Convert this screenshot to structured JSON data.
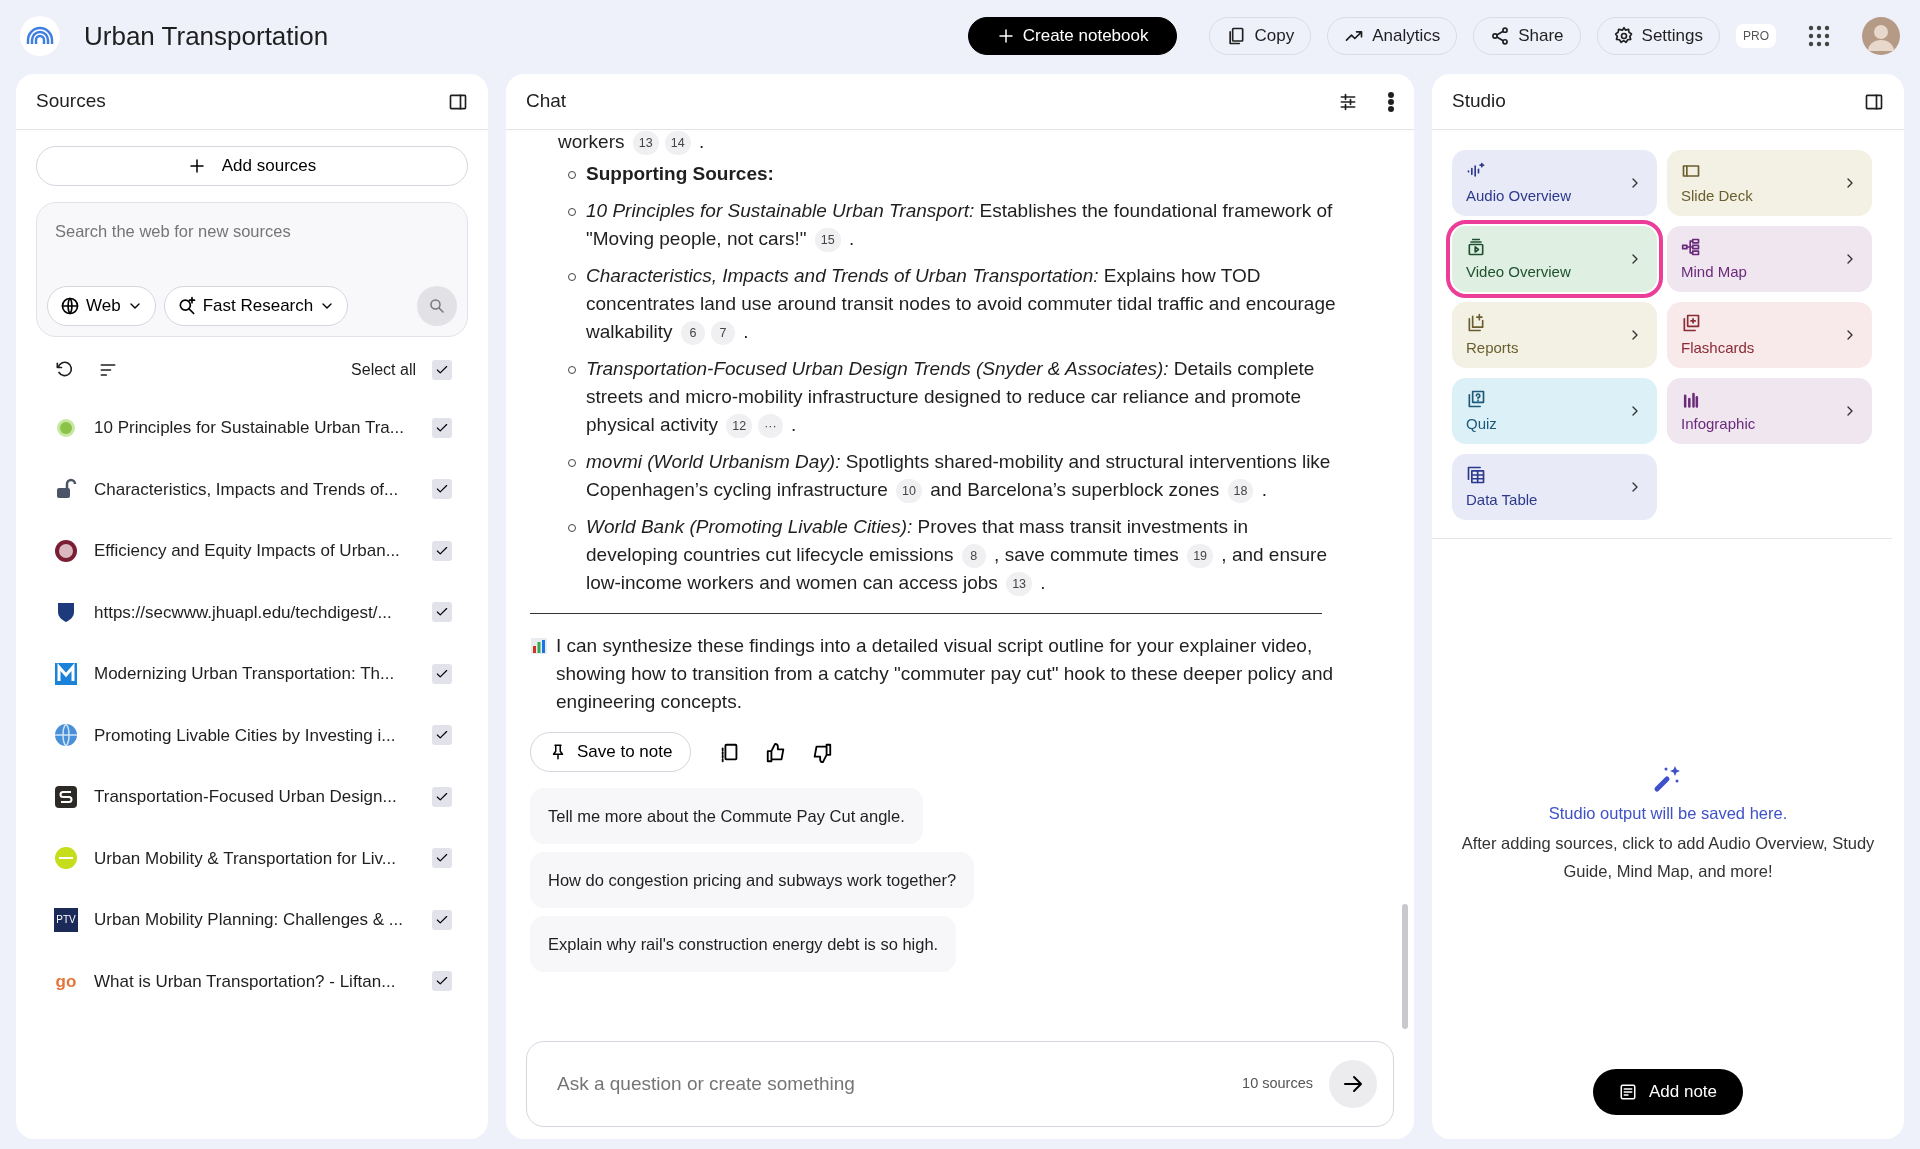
{
  "app": {
    "title": "Urban Transportation"
  },
  "toolbar": {
    "buttons": [
      {
        "kind": "create",
        "label": "Create notebook"
      },
      {
        "kind": "copy",
        "label": "Copy"
      },
      {
        "kind": "analytics",
        "label": "Analytics"
      },
      {
        "kind": "share",
        "label": "Share"
      },
      {
        "kind": "settings",
        "label": "Settings"
      }
    ],
    "badge": "PRO"
  },
  "sources": {
    "title": "Sources",
    "add_button": "Add sources",
    "search": {
      "placeholder": "Search the web for new sources",
      "web_dropdown": "Web",
      "research_dropdown": "Fast Research"
    },
    "select_all": {
      "label": "Select all",
      "checked": true
    },
    "items": [
      {
        "title": "10 Principles for Sustainable Urban Tra...",
        "checked": true
      },
      {
        "title": "Characteristics, Impacts and Trends of...",
        "checked": true
      },
      {
        "title": "Efficiency and Equity Impacts of Urban...",
        "checked": true
      },
      {
        "title": "https://secwww.jhuapl.edu/techdigest/...",
        "checked": true
      },
      {
        "title": "Modernizing Urban Transportation: Th...",
        "checked": true
      },
      {
        "title": "Promoting Livable Cities by Investing i...",
        "checked": true
      },
      {
        "title": "Transportation-Focused Urban Design...",
        "checked": true
      },
      {
        "title": "Urban Mobility & Transportation for Liv...",
        "checked": true
      },
      {
        "title": "Urban Mobility Planning: Challenges & ...",
        "logo_text": "PTV",
        "checked": true
      },
      {
        "title": "What is Urban Transportation? - Liftan...",
        "logo_text": "go",
        "checked": true
      }
    ]
  },
  "chat": {
    "title": "Chat",
    "lead": [
      {
        "kind": "text",
        "text": "workers"
      },
      {
        "kind": "cite",
        "text": "13"
      },
      {
        "kind": "cite",
        "text": "14"
      },
      {
        "kind": "text",
        "text": "."
      }
    ],
    "bullets": [
      {
        "kind": "heading",
        "parts": [
          {
            "kind": "text",
            "text": "Supporting Sources:"
          }
        ]
      },
      {
        "kind": "item",
        "parts": [
          {
            "kind": "text",
            "text": "*10 Principles for Sustainable Urban Transport:* Establishes the foundational framework of \"Moving people, not cars!\""
          },
          {
            "kind": "cite",
            "text": "15"
          },
          {
            "kind": "text",
            "text": "."
          }
        ]
      },
      {
        "kind": "item",
        "parts": [
          {
            "kind": "text",
            "text": "*Characteristics, Impacts and Trends of Urban Transportation:* Explains how TOD concentrates land use around transit nodes to avoid commuter tidal traffic and encourage walkability"
          },
          {
            "kind": "cite",
            "text": "6"
          },
          {
            "kind": "cite",
            "text": "7"
          },
          {
            "kind": "text",
            "text": "."
          }
        ]
      },
      {
        "kind": "item",
        "parts": [
          {
            "kind": "text",
            "text": "*Transportation-Focused Urban Design Trends (Snyder & Associates):* Details complete streets and micro-mobility infrastructure designed to reduce car reliance and promote physical activity"
          },
          {
            "kind": "cite",
            "text": "12"
          },
          {
            "kind": "cite",
            "text": "···"
          },
          {
            "kind": "text",
            "text": "."
          }
        ]
      },
      {
        "kind": "item",
        "parts": [
          {
            "kind": "text",
            "text": "*movmi (World Urbanism Day):* Spotlights shared-mobility and structural interventions like Copenhagen’s cycling infrastructure"
          },
          {
            "kind": "cite",
            "text": "10"
          },
          {
            "kind": "text",
            "text": "and Barcelona’s superblock zones"
          },
          {
            "kind": "cite",
            "text": "18"
          },
          {
            "kind": "text",
            "text": "."
          }
        ]
      },
      {
        "kind": "item",
        "parts": [
          {
            "kind": "text",
            "text": "*World Bank (Promoting Livable Cities):* Proves that mass transit investments in developing countries cut lifecycle emissions"
          },
          {
            "kind": "cite",
            "text": "8"
          },
          {
            "kind": "text",
            "text": ", save commute times"
          },
          {
            "kind": "cite",
            "text": "19"
          },
          {
            "kind": "text",
            "text": ", and ensure low-income workers and women can access jobs"
          },
          {
            "kind": "cite",
            "text": "13"
          },
          {
            "kind": "text",
            "text": "."
          }
        ]
      }
    ],
    "closing": "I can synthesize these findings into a detailed visual script outline for your explainer video, showing how to transition from a catchy \"commuter pay cut\" hook to these deeper policy and engineering concepts.",
    "save_button": "Save to note",
    "suggestions": [
      "Tell me more about the Commute Pay Cut angle.",
      "How do congestion pricing and subways work together?",
      "Explain why rail's construction energy debt is so high."
    ],
    "input": {
      "placeholder": "Ask a question or create something",
      "source_count": "10 sources"
    }
  },
  "studio": {
    "title": "Studio",
    "tiles": [
      {
        "kind": "audio",
        "label": "Audio Overview",
        "selected": false
      },
      {
        "kind": "slides",
        "label": "Slide Deck",
        "selected": false
      },
      {
        "kind": "video",
        "label": "Video Overview",
        "selected": true
      },
      {
        "kind": "mindmap",
        "label": "Mind Map",
        "selected": false
      },
      {
        "kind": "reports",
        "label": "Reports",
        "selected": false
      },
      {
        "kind": "flashcards",
        "label": "Flashcards",
        "selected": false
      },
      {
        "kind": "quiz",
        "label": "Quiz",
        "selected": false
      },
      {
        "kind": "infographic",
        "label": "Infographic",
        "selected": false
      },
      {
        "kind": "table",
        "label": "Data Table",
        "selected": false
      }
    ],
    "empty_title": "Studio output will be saved here.",
    "empty_text": "After adding sources, click to add Audio Overview, Study Guide, Mind Map, and more!",
    "add_note": "Add note"
  }
}
